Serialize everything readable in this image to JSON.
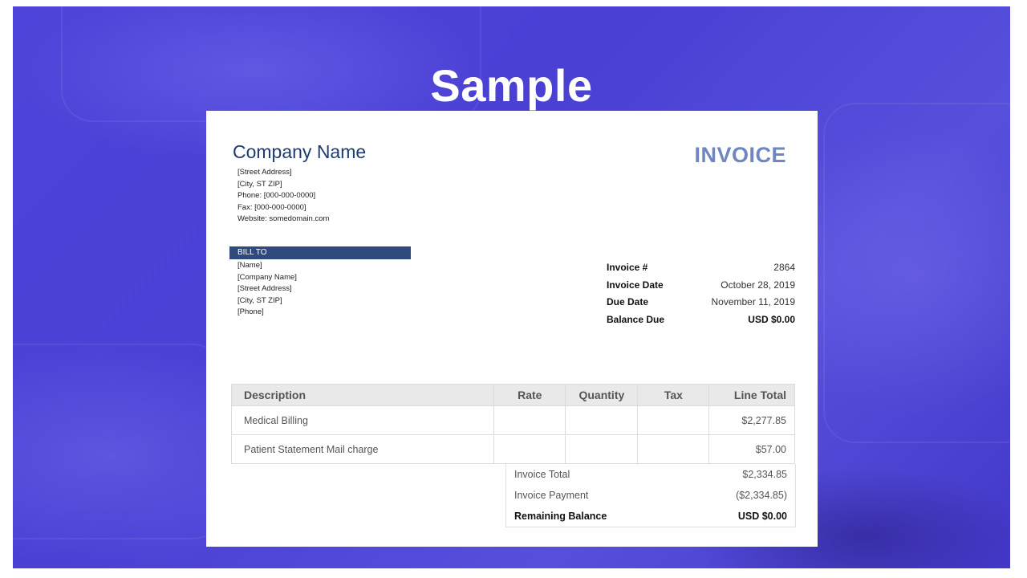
{
  "headline": "Sample",
  "company": {
    "name": "Company Name",
    "address_lines": [
      "[Street Address]",
      "[City, ST  ZIP]",
      "Phone: [000-000-0000]",
      "Fax: [000-000-0000]",
      "Website: somedomain.com"
    ]
  },
  "invoice_title": "INVOICE",
  "bill_to": {
    "label": "BILL TO",
    "lines": [
      "[Name]",
      "[Company Name]",
      "[Street Address]",
      "[City, ST  ZIP]",
      "[Phone]"
    ]
  },
  "meta": [
    {
      "label": "Invoice #",
      "value": "2864"
    },
    {
      "label": "Invoice Date",
      "value": "October 28, 2019"
    },
    {
      "label": "Due Date",
      "value": "November 11, 2019"
    },
    {
      "label": "Balance Due",
      "value": "USD $0.00"
    }
  ],
  "items_table": {
    "headers": [
      "Description",
      "Rate",
      "Quantity",
      "Tax",
      "Line Total"
    ],
    "rows": [
      {
        "description": "Medical Billing",
        "rate": "",
        "quantity": "",
        "tax": "",
        "total": "$2,277.85"
      },
      {
        "description": "Patient Statement Mail charge",
        "rate": "",
        "quantity": "",
        "tax": "",
        "total": "$57.00"
      }
    ]
  },
  "totals": [
    {
      "label": "Invoice Total",
      "value": "$2,334.85"
    },
    {
      "label": "Invoice Payment",
      "value": "($2,334.85)"
    },
    {
      "label": "Remaining Balance",
      "value": "USD $0.00"
    }
  ],
  "colors": {
    "background": "#4e44d9",
    "company_name": "#1f3b73",
    "invoice_title": "#6f86c0",
    "bill_to_bar": "#2f4a7c",
    "table_header": "#e9e9e9"
  }
}
